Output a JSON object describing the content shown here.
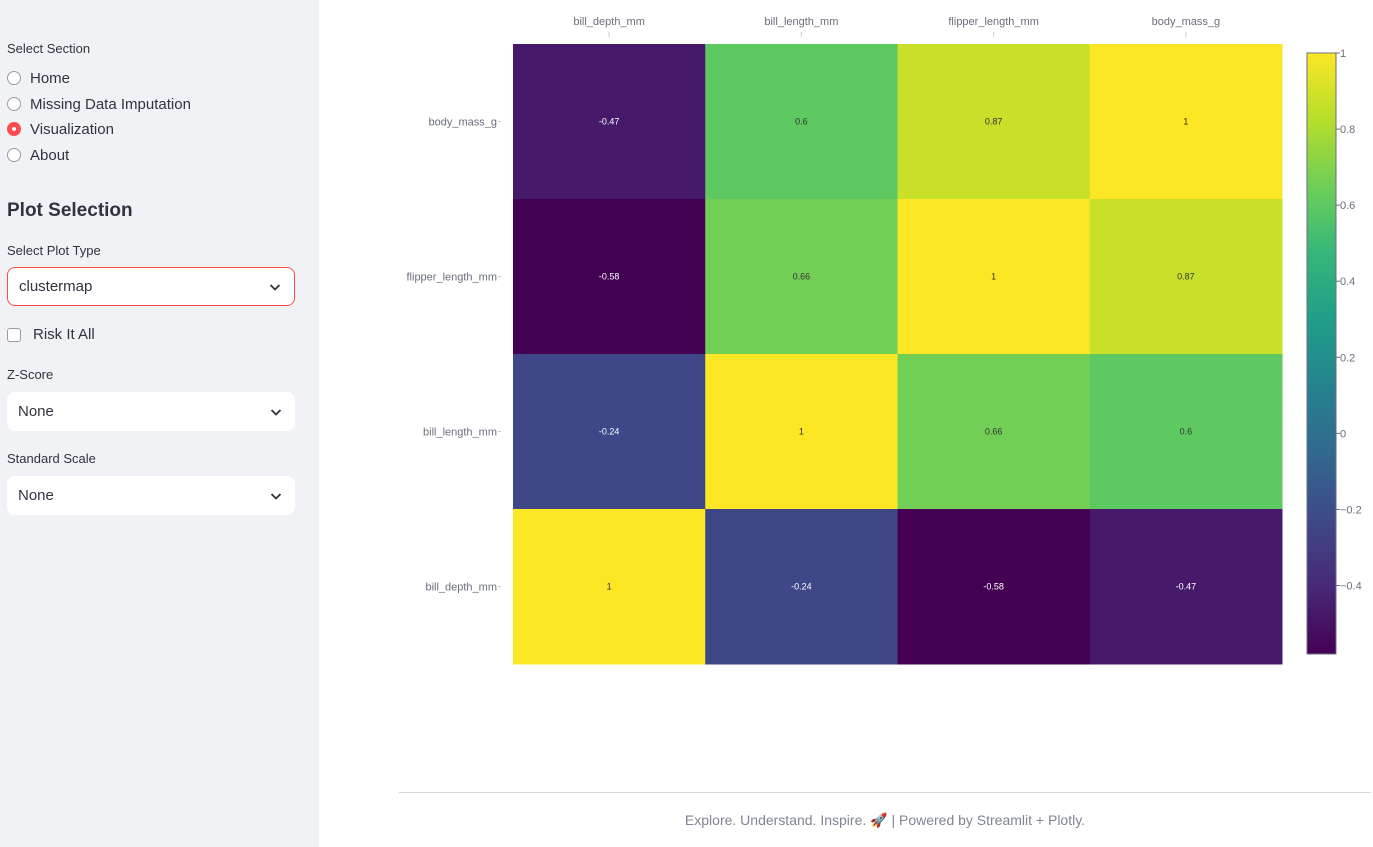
{
  "sidebar": {
    "section_label": "Select Section",
    "sections": [
      {
        "label": "Home",
        "selected": false
      },
      {
        "label": "Missing Data Imputation",
        "selected": false
      },
      {
        "label": "Visualization",
        "selected": true
      },
      {
        "label": "About",
        "selected": false
      }
    ],
    "plot_heading": "Plot Selection",
    "plot_type_label": "Select Plot Type",
    "plot_type_value": "clustermap",
    "risk_label": "Risk It All",
    "risk_checked": false,
    "zscore_label": "Z-Score",
    "zscore_value": "None",
    "scale_label": "Standard Scale",
    "scale_value": "None"
  },
  "footer": {
    "text": "Explore. Understand. Inspire. 🚀 | Powered by Streamlit + Plotly."
  },
  "chart_data": {
    "type": "heatmap",
    "x": [
      "bill_depth_mm",
      "bill_length_mm",
      "flipper_length_mm",
      "body_mass_g"
    ],
    "y": [
      "body_mass_g",
      "flipper_length_mm",
      "bill_length_mm",
      "bill_depth_mm"
    ],
    "z": [
      [
        -0.47,
        0.6,
        0.87,
        1
      ],
      [
        -0.58,
        0.66,
        1,
        0.87
      ],
      [
        -0.24,
        1,
        0.66,
        0.6
      ],
      [
        1,
        -0.24,
        -0.58,
        -0.47
      ]
    ],
    "zlim": [
      -0.58,
      1
    ],
    "colorscale": "Viridis",
    "colorbar_ticks": [
      1,
      0.8,
      0.6,
      0.4,
      0.2,
      0,
      -0.2,
      -0.4
    ],
    "colorbar_tick_labels": [
      "1",
      "0.8",
      "0.6",
      "0.4",
      "0.2",
      "0",
      "−0.2",
      "−0.4"
    ],
    "x_axis_position": "top",
    "annotations": true
  }
}
